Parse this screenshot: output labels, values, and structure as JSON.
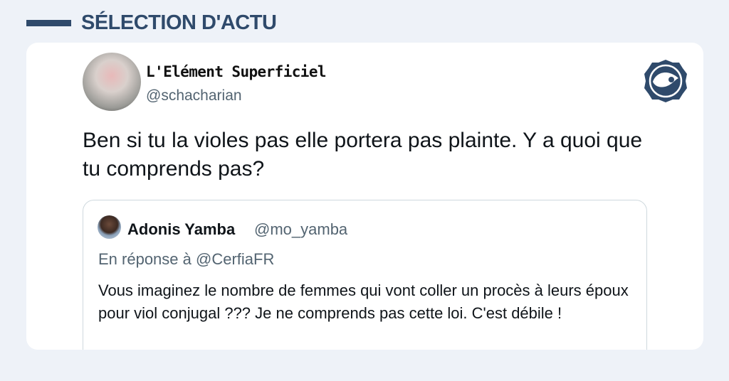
{
  "header": {
    "title": "SÉLECTION D'ACTU"
  },
  "tweet": {
    "author_name": "L'Elément Superficiel",
    "author_handle": "@schacharian",
    "text": "Ben si tu la violes pas elle portera pas plainte. Y a quoi que tu comprends pas?",
    "brand_icon": "brand-logo-icon",
    "quoted": {
      "author_name": "Adonis Yamba",
      "author_handle": "@mo_yamba",
      "reply_to": "En réponse à @CerfiaFR",
      "text": "Vous imaginez le nombre de femmes qui vont coller un procès à leurs époux pour viol conjugal ??? Je ne comprends pas cette loi. C'est débile !"
    }
  },
  "colors": {
    "page_background": "#eef2f8",
    "brand": "#2f4a6b",
    "secondary_text": "#536471",
    "quote_border": "#cfd9de"
  }
}
